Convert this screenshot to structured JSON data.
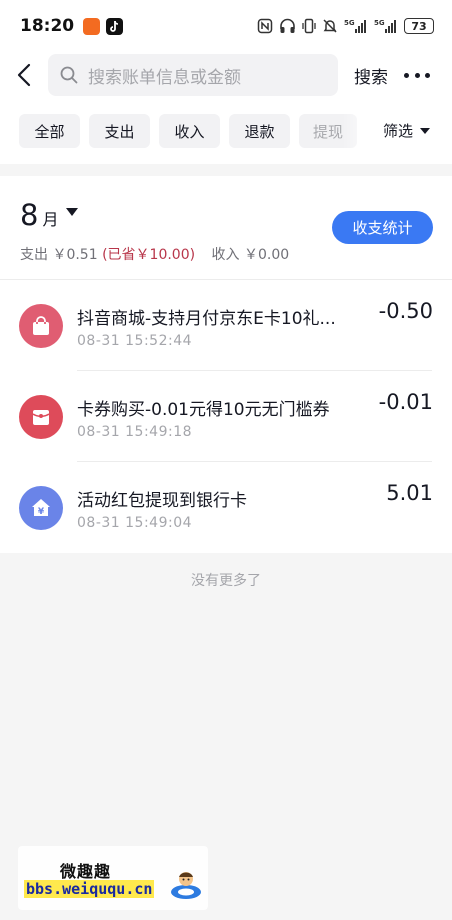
{
  "status_bar": {
    "time": "18:20",
    "battery": "73",
    "icons": [
      "nfc-icon",
      "headphones-icon",
      "vibrate-icon",
      "mute-icon",
      "signal-5g-icon",
      "signal-5g-icon"
    ]
  },
  "header": {
    "search_placeholder": "搜索账单信息或金额",
    "search_button": "搜索"
  },
  "filters": {
    "chips": [
      "全部",
      "支出",
      "收入",
      "退款",
      "提现"
    ],
    "filter_label": "筛选"
  },
  "month": {
    "number": "8",
    "unit": "月",
    "expense_label": "支出",
    "expense_value": "￥0.51",
    "saved_text": "(已省￥10.00)",
    "income_label": "收入",
    "income_value": "￥0.00",
    "stats_button": "收支统计"
  },
  "transactions": [
    {
      "title": "抖音商城-支持月付京东E卡10礼...",
      "time": "08-31 15:52:44",
      "amount": "-0.50",
      "icon": "shopping-bag-icon",
      "icon_color": "#e05d72"
    },
    {
      "title": "卡券购买-0.01元得10元无门槛券",
      "time": "08-31 15:49:18",
      "amount": "-0.01",
      "icon": "red-envelope-icon",
      "icon_color": "#de4b5a"
    },
    {
      "title": "活动红包提现到银行卡",
      "time": "08-31 15:49:04",
      "amount": "5.01",
      "icon": "bank-house-icon",
      "icon_color": "#6a84e8"
    }
  ],
  "footer_text": "没有更多了",
  "watermark": {
    "title": "微趣趣",
    "url": "bbs.weiququ.cn"
  },
  "colors": {
    "accent": "#3a79f3",
    "saved": "#b8364a",
    "muted": "#a5a6ab"
  }
}
